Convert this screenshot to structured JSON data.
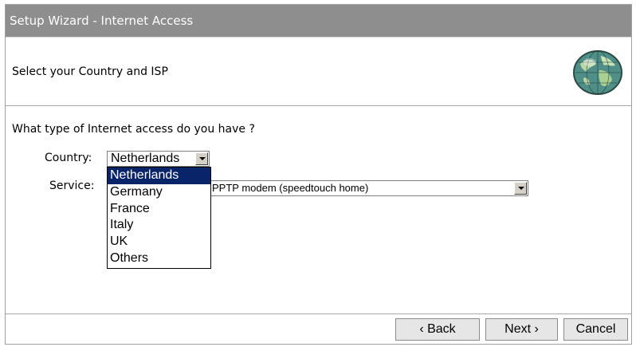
{
  "window": {
    "title": "Setup Wizard - Internet Access"
  },
  "header": {
    "text": "Select your Country and ISP",
    "icon": "globe-icon"
  },
  "main": {
    "question": "What type of Internet access do you have ?",
    "country": {
      "label": "Country:",
      "value": "Netherlands",
      "options": [
        "Netherlands",
        "Germany",
        "France",
        "Italy",
        "UK",
        "Others"
      ],
      "dropdown_open": true
    },
    "service": {
      "label": "Service:",
      "value": "PPTP modem (speedtouch home)"
    }
  },
  "footer": {
    "back_label": "‹ Back",
    "next_label": "Next ›",
    "cancel_label": "Cancel"
  },
  "colors": {
    "titlebar": "#8e8e8e",
    "selection": "#0a246a",
    "button_face": "#e6e6e6"
  }
}
